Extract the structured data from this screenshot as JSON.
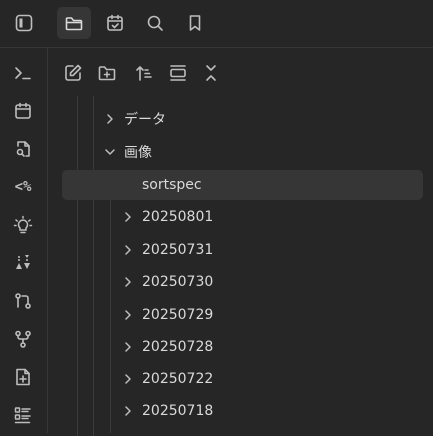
{
  "topbar": {
    "tabs": [
      {
        "icon": "sidebar-toggle-icon"
      },
      {
        "icon": "folder-icon",
        "active": true
      },
      {
        "icon": "calendar-check-icon"
      },
      {
        "icon": "search-icon"
      },
      {
        "icon": "bookmark-icon"
      }
    ]
  },
  "ribbon": {
    "items": [
      {
        "icon": "terminal-icon"
      },
      {
        "icon": "calendar-icon"
      },
      {
        "icon": "file-search-icon"
      },
      {
        "icon": "templater-icon",
        "text": "<%"
      },
      {
        "icon": "lightbulb-icon"
      },
      {
        "icon": "sort-arrows-icon"
      },
      {
        "icon": "git-compare-icon"
      },
      {
        "icon": "git-fork-icon"
      },
      {
        "icon": "file-plus-icon"
      },
      {
        "icon": "list-icon"
      }
    ]
  },
  "explorer": {
    "toolbar": [
      {
        "icon": "new-note-icon"
      },
      {
        "icon": "new-folder-icon"
      },
      {
        "icon": "sort-icon"
      },
      {
        "icon": "auto-reveal-icon"
      },
      {
        "icon": "collapse-all-icon"
      }
    ],
    "tree": [
      {
        "label": "データ",
        "expanded": false
      },
      {
        "label": "画像",
        "expanded": true
      },
      {
        "label": "sortspec",
        "selected": true
      },
      {
        "label": "20250801"
      },
      {
        "label": "20250731"
      },
      {
        "label": "20250730"
      },
      {
        "label": "20250729"
      },
      {
        "label": "20250728"
      },
      {
        "label": "20250722"
      },
      {
        "label": "20250718"
      }
    ]
  },
  "colors": {
    "background": "#262626",
    "active": "#363636",
    "icon": "#bdbdbd",
    "text": "#dadada"
  }
}
